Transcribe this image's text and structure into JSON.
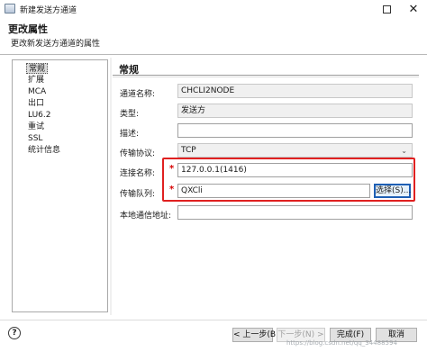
{
  "window": {
    "title": "新建发送方通道",
    "close_glyph": "✕"
  },
  "header": {
    "title": "更改属性",
    "subtitle": "更改新发送方通道的属性"
  },
  "nav": {
    "items": [
      {
        "label": "常规",
        "selected": true
      },
      {
        "label": "扩展"
      },
      {
        "label": "MCA"
      },
      {
        "label": "出口"
      },
      {
        "label": "LU6.2"
      },
      {
        "label": "重试"
      },
      {
        "label": "SSL"
      },
      {
        "label": "统计信息"
      }
    ]
  },
  "section": {
    "title": "常规"
  },
  "form": {
    "channel_name": {
      "label": "通道名称:",
      "value": "CHCLI2NODE"
    },
    "type": {
      "label": "类型:",
      "value": "发送方"
    },
    "description": {
      "label": "描述:",
      "value": ""
    },
    "protocol": {
      "label": "传输协议:",
      "value": "TCP"
    },
    "conn_name": {
      "label": "连接名称:",
      "value": "127.0.0.1(1416)"
    },
    "xmit_queue": {
      "label": "传输队列:",
      "value": "QXCli"
    },
    "local_addr": {
      "label": "本地通信地址:",
      "value": ""
    },
    "required_marker": "*",
    "choose_button": "选择(S)..."
  },
  "footer": {
    "help": "?",
    "back": "< 上一步(B)",
    "next": "下一步(N) >",
    "finish": "完成(F)",
    "cancel": "取消"
  },
  "watermark": "https://blog.csdn.net/qq_34488594",
  "colors": {
    "highlight_box": "#e02020",
    "required_marker": "#d60000",
    "focused_button_border": "#1e5fb4"
  }
}
